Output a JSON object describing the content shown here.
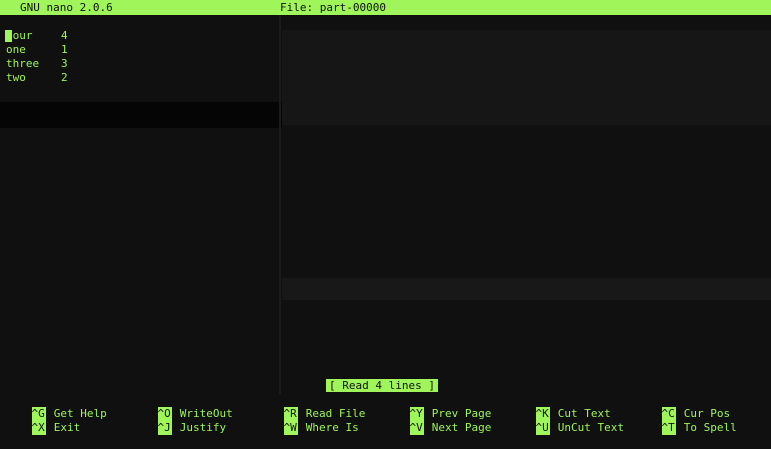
{
  "titlebar": {
    "app_version": "GNU nano 2.0.6",
    "file_label": "File: part-00000"
  },
  "buffer": {
    "lines": [
      {
        "word": "four",
        "count": "4"
      },
      {
        "word": "one",
        "count": "1"
      },
      {
        "word": "three",
        "count": "3"
      },
      {
        "word": "two",
        "count": "2"
      }
    ]
  },
  "status_message": "[ Read 4 lines ]",
  "shortcuts": [
    {
      "key": "^G",
      "label": "Get Help"
    },
    {
      "key": "^X",
      "label": "Exit"
    },
    {
      "key": "^O",
      "label": "WriteOut"
    },
    {
      "key": "^J",
      "label": "Justify"
    },
    {
      "key": "^R",
      "label": "Read File"
    },
    {
      "key": "^W",
      "label": "Where Is"
    },
    {
      "key": "^Y",
      "label": "Prev Page"
    },
    {
      "key": "^V",
      "label": "Next Page"
    },
    {
      "key": "^K",
      "label": "Cut Text"
    },
    {
      "key": "^U",
      "label": "UnCut Text"
    },
    {
      "key": "^C",
      "label": "Cur Pos"
    },
    {
      "key": "^T",
      "label": "To Spell"
    }
  ],
  "colors": {
    "foreground": "#9ff55a",
    "background": "#101010"
  }
}
